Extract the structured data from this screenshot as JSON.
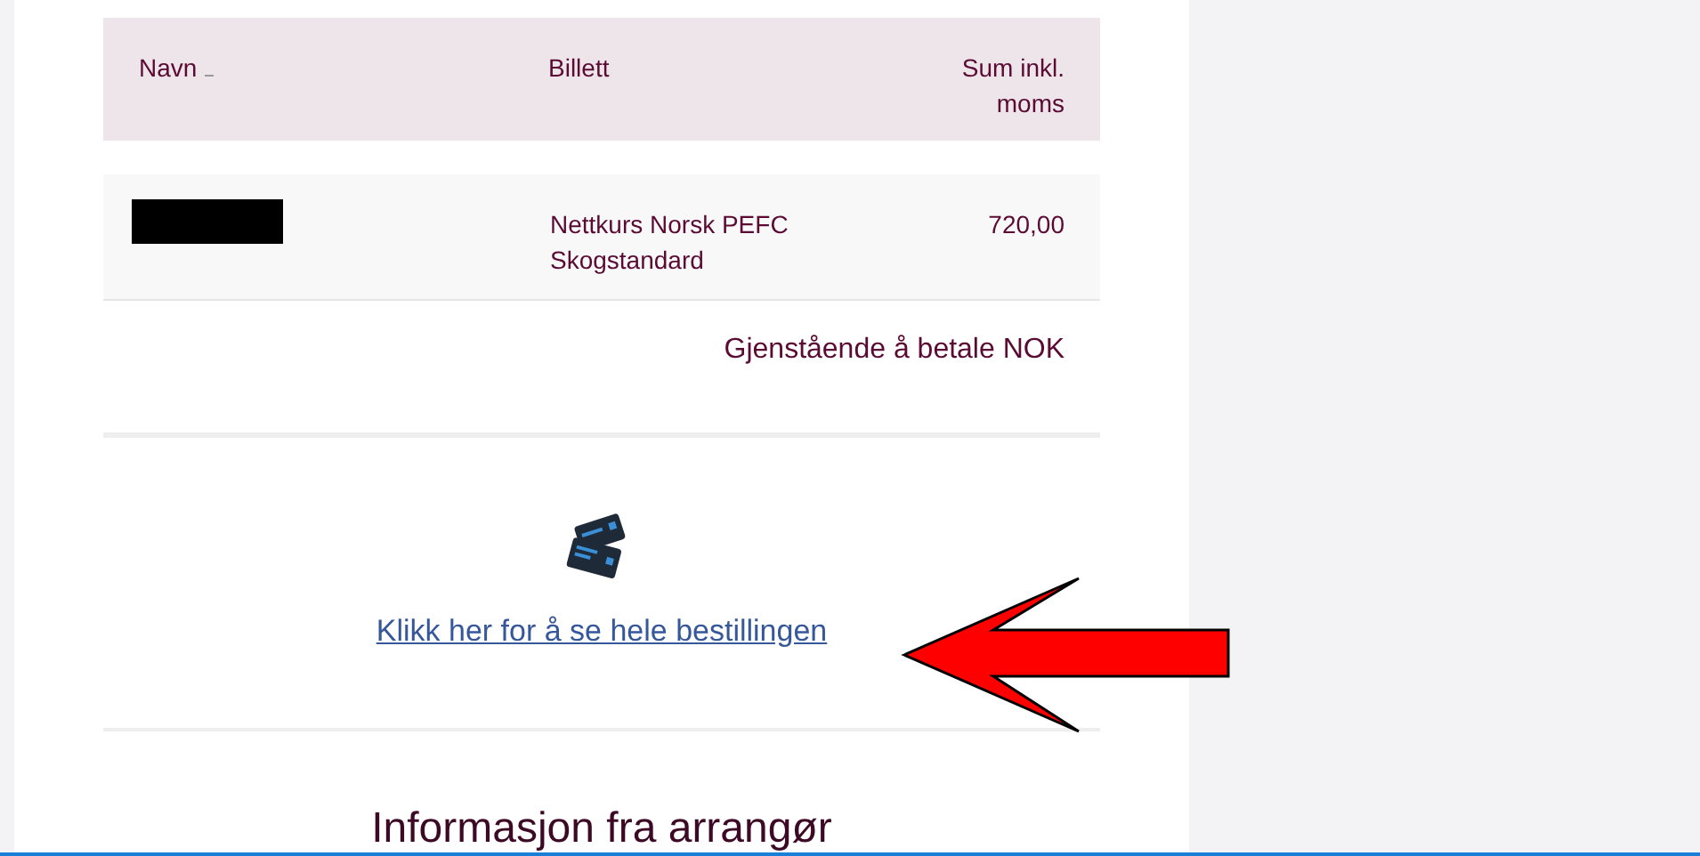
{
  "table": {
    "columns": [
      {
        "label": "Navn",
        "sortable": true
      },
      {
        "label": "Billett",
        "sortable": false
      },
      {
        "label": "Sum inkl. moms",
        "sortable": false
      }
    ],
    "rows": [
      {
        "name_redacted": true,
        "ticket": "Nettkurs Norsk PEFC Skogstandard",
        "sum": "720,00"
      }
    ],
    "remaining": "Gjenstående å betale NOK"
  },
  "order_link": "Klikk her for å se hele bestillingen",
  "info_heading": "Informasjon fra arrangør"
}
